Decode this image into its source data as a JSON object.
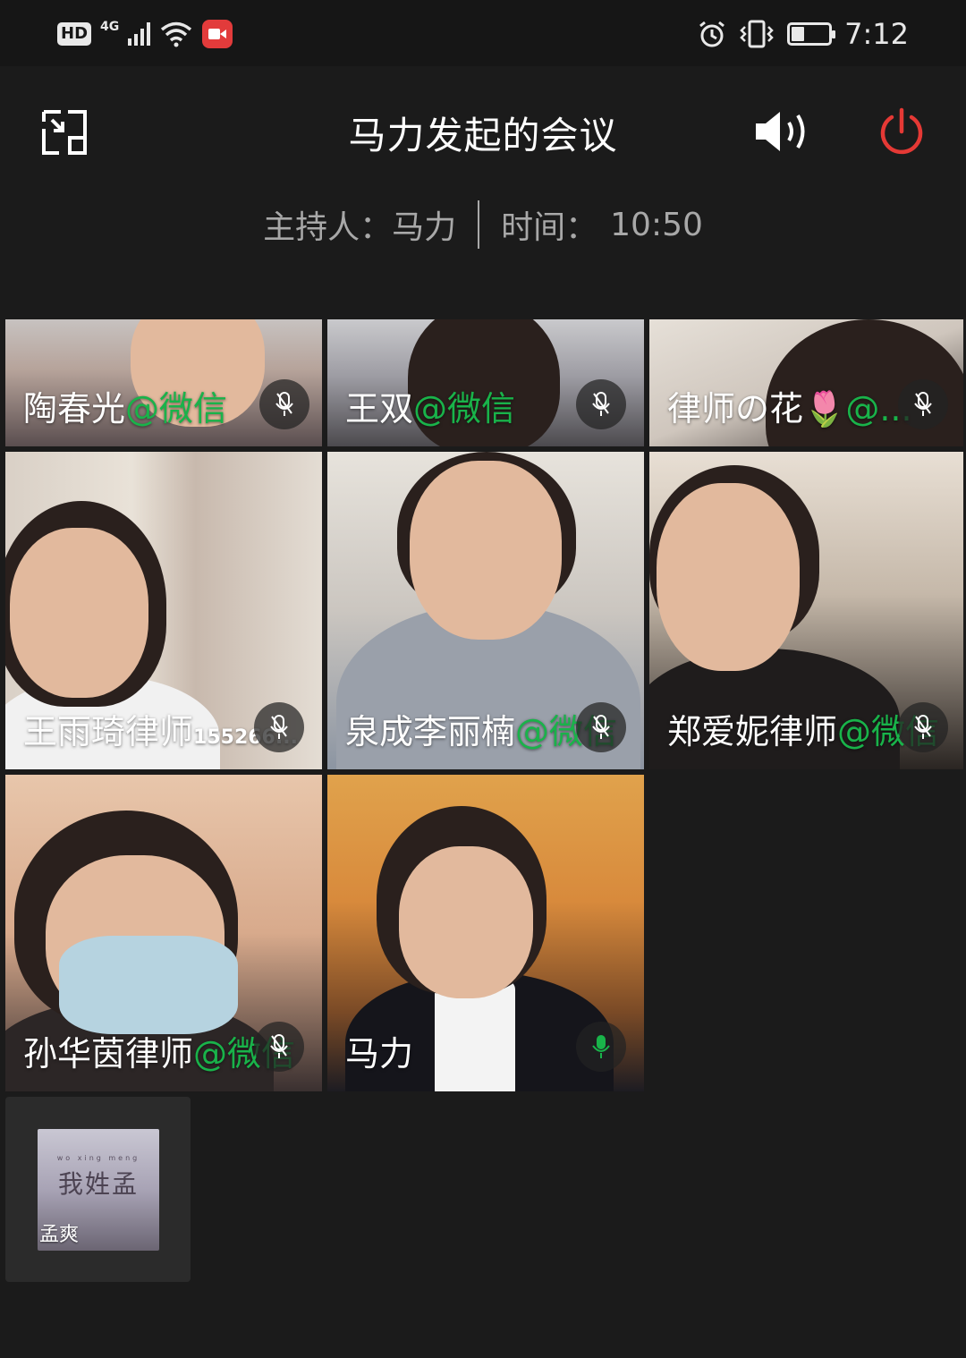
{
  "status_bar": {
    "hd_label": "HD",
    "network_label": "4G",
    "time": "7:12",
    "battery_level": 0.35,
    "icons": [
      "signal-icon",
      "wifi-icon",
      "screen-record-icon",
      "alarm-icon",
      "vibrate-icon",
      "battery-icon"
    ]
  },
  "header": {
    "title": "马力发起的会议",
    "host_label": "主持人：",
    "host_name": "马力",
    "time_label": "时间：",
    "time_value": "10:50",
    "icons": [
      "shrink-window-icon",
      "speaker-icon",
      "power-icon"
    ]
  },
  "colors": {
    "background": "#1b1b1b",
    "wechat_green": "#19b34a",
    "power_red": "#e53935"
  },
  "participants": [
    {
      "name": "陶春光",
      "suffix": "@微信",
      "mic": "muted"
    },
    {
      "name": "王双",
      "suffix": "@微信",
      "mic": "muted"
    },
    {
      "name": "律师の花🌷",
      "suffix": "@...",
      "mic": "muted"
    },
    {
      "name": "王雨琦律师",
      "extra": "155266...",
      "mic": "muted"
    },
    {
      "name": "泉成李丽楠",
      "suffix": "@微信",
      "mic": "muted"
    },
    {
      "name": "郑爱妮律师",
      "suffix": "@微信",
      "mic": "muted"
    },
    {
      "name": "孙华茵律师",
      "suffix": "@微信",
      "mic": "muted"
    },
    {
      "name": "马力",
      "suffix": "",
      "mic": "on"
    }
  ],
  "self_tile": {
    "name": "孟爽",
    "avatar_title": "我姓孟",
    "avatar_pinyin": "wo xing meng"
  }
}
